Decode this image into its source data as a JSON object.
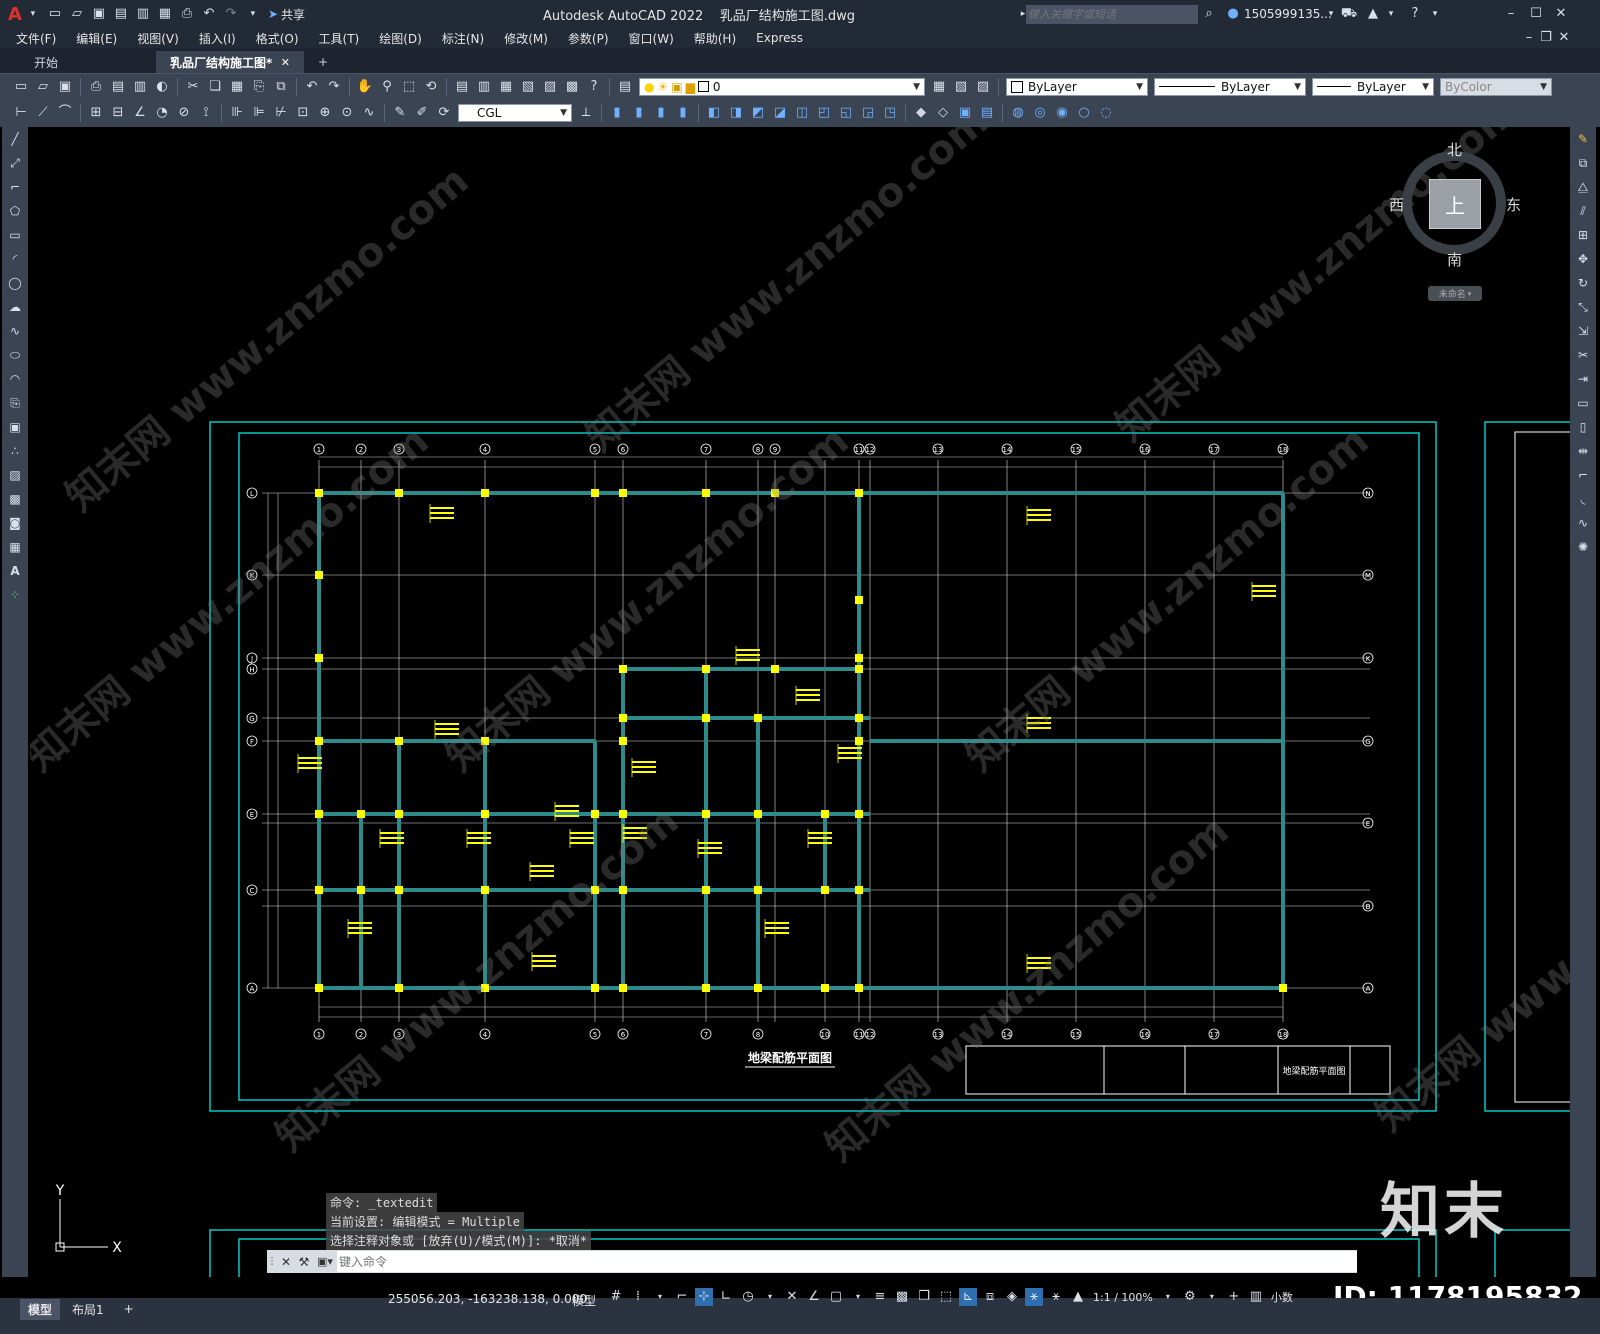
{
  "app": {
    "title": "Autodesk AutoCAD 2022",
    "file": "乳品厂结构施工图.dwg",
    "share": "共享",
    "search_placeholder": "键入关键字或短语",
    "user": "1505999135..."
  },
  "menu": [
    "文件(F)",
    "编辑(E)",
    "视图(V)",
    "插入(I)",
    "格式(O)",
    "工具(T)",
    "绘图(D)",
    "标注(N)",
    "修改(M)",
    "参数(P)",
    "窗口(W)",
    "帮助(H)",
    "Express"
  ],
  "tabs": [
    {
      "label": "开始"
    },
    {
      "label": "乳品厂结构施工图*"
    }
  ],
  "toolbar": {
    "layer_value": "0",
    "color_value": "ByLayer",
    "linetype_value": "ByLayer",
    "lineweight_value": "ByLayer",
    "plotstyle_value": "ByColor",
    "textstyle_value": "CGL"
  },
  "viewcube": {
    "north": "北",
    "south": "南",
    "east": "东",
    "west": "西",
    "top": "上",
    "ucs": "未命名"
  },
  "drawing": {
    "title": "地梁配筋平面图",
    "grid_top": [
      "1",
      "2",
      "3",
      "4",
      "5",
      "6",
      "7",
      "8",
      "9",
      "11",
      "12",
      "13",
      "14",
      "15",
      "16",
      "17",
      "18"
    ],
    "grid_bottom": [
      "1",
      "2",
      "3",
      "4",
      "5",
      "6",
      "7",
      "8",
      "10",
      "11",
      "12",
      "13",
      "14",
      "15",
      "16",
      "17",
      "18"
    ],
    "grid_left": [
      "L",
      "K",
      "J",
      "H",
      "G",
      "F",
      "E",
      "C",
      "A"
    ],
    "grid_right": [
      "N",
      "M",
      "K",
      "G",
      "E",
      "B",
      "A"
    ],
    "title_block": "地梁配筋平面图"
  },
  "ucs_icon": {
    "x": "X",
    "y": "Y"
  },
  "command": {
    "history": [
      "命令: _textedit",
      "当前设置: 编辑模式 = Multiple",
      "选择注释对象或 [放弃(U)/模式(M)]: *取消*"
    ],
    "placeholder": "键入命令"
  },
  "layout_tabs": [
    "模型",
    "布局1"
  ],
  "status": {
    "coords": "255056.203, -163238.138, 0.000",
    "mode": "模型",
    "scale": "1:1 / 100%",
    "units": "小数"
  },
  "watermark": {
    "logo": "知末",
    "id": "ID: 1178195832",
    "text": "知末网 www.znzmo.com"
  },
  "colors": {
    "bg": "#000000",
    "chrome": "#3b4453",
    "title_bg": "#222a35",
    "frame": "#00c8c8",
    "beam": "#2e8b8b",
    "column": "#ffff00",
    "line": "#ffffff"
  }
}
